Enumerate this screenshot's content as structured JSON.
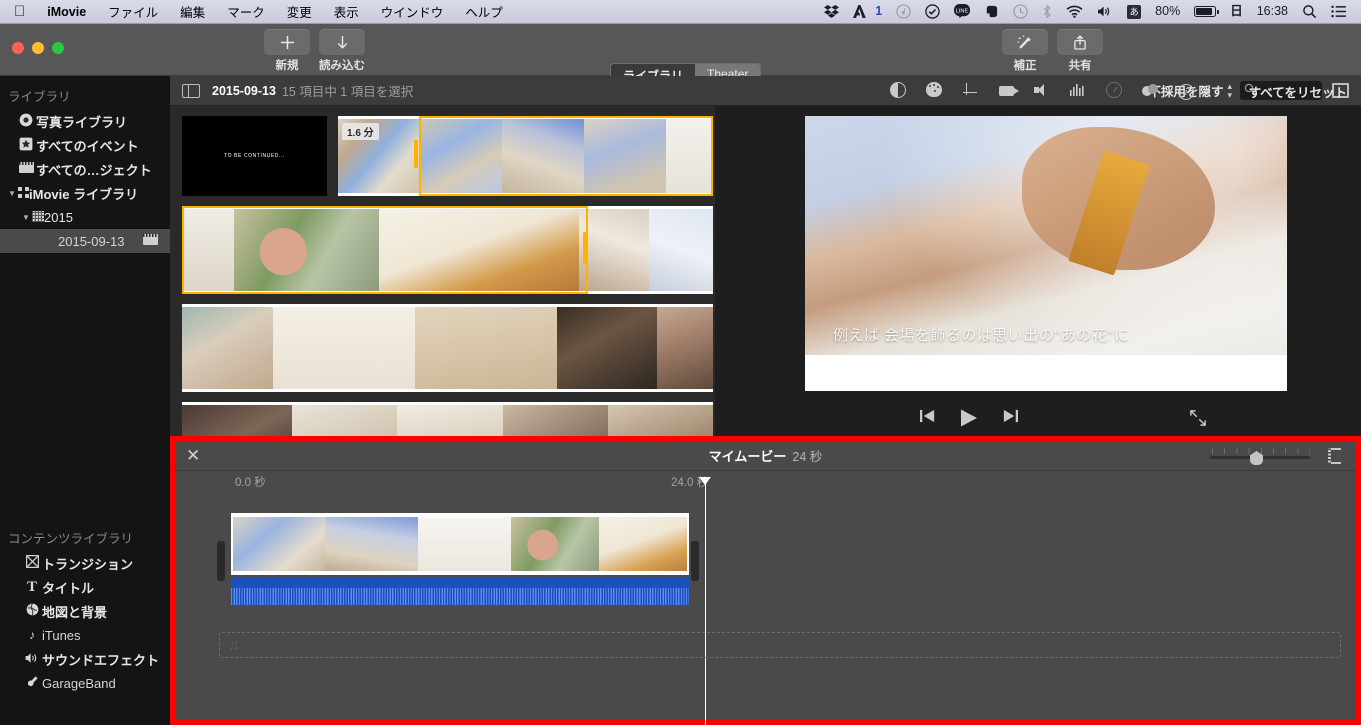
{
  "menubar": {
    "apple": "apple-logo",
    "items": [
      "iMovie",
      "ファイル",
      "編集",
      "マーク",
      "変更",
      "表示",
      "ウインドウ",
      "ヘルプ"
    ],
    "status": {
      "dropbox": "dropbox-icon",
      "adobe_badge": "1",
      "input_source": "あ",
      "battery_percent": "80%",
      "date_icon": "日",
      "time": "16:38"
    }
  },
  "titlebar": {
    "buttons": [
      {
        "name": "new",
        "glyph": "+",
        "label": "新規"
      },
      {
        "name": "import",
        "glyph": "↓",
        "label": "読み込む"
      },
      {
        "name": "enhance",
        "glyph": "✨",
        "label": "補正"
      },
      {
        "name": "share",
        "glyph": "⬆",
        "label": "共有"
      }
    ],
    "segments": [
      {
        "label": "ライブラリ",
        "selected": true
      },
      {
        "label": "Theater",
        "selected": false
      }
    ]
  },
  "sidebar": {
    "library_header": "ライブラリ",
    "library_items": [
      {
        "label": "写真ライブラリ",
        "icon": "photos-icon"
      },
      {
        "label": "すべてのイベント",
        "icon": "star-icon"
      },
      {
        "label": "すべての…ジェクト",
        "icon": "film-icon"
      }
    ],
    "imovie_library": "iMovie ライブラリ",
    "year": "2015",
    "event": "2015-09-13",
    "content_header": "コンテンツライブラリ",
    "content_items": [
      {
        "label": "トランジション",
        "icon": "transition-icon",
        "bold": true
      },
      {
        "label": "タイトル",
        "icon": "title-icon",
        "bold": true
      },
      {
        "label": "地図と背景",
        "icon": "globe-icon",
        "bold": true
      },
      {
        "label": "iTunes",
        "icon": "music-note-icon",
        "bold": false
      },
      {
        "label": "サウンドエフェクト",
        "icon": "speaker-icon",
        "bold": true
      },
      {
        "label": "GarageBand",
        "icon": "guitar-icon",
        "bold": false
      }
    ]
  },
  "browser_toolbar": {
    "sidebar_toggle": "sidebar-toggle-icon",
    "date": "2015-09-13",
    "count": "15 項目中 1 項目を選択",
    "hide_rejected": "不採用を隠す",
    "search_placeholder": "",
    "search_value": "",
    "filmstrip_view": "filmstrip-view-icon"
  },
  "adjust_bar": {
    "icons": [
      {
        "name": "color-balance-icon",
        "dim": false
      },
      {
        "name": "color-correction-icon",
        "dim": false
      },
      {
        "name": "crop-icon",
        "dim": false
      },
      {
        "name": "stabilization-icon",
        "dim": false
      },
      {
        "name": "volume-icon",
        "dim": false
      },
      {
        "name": "noise-reduction-icon",
        "dim": true
      },
      {
        "name": "speed-icon",
        "dim": true
      },
      {
        "name": "clip-filter-icon",
        "dim": false
      },
      {
        "name": "info-icon",
        "dim": false
      }
    ],
    "reset_all": "すべてをリセット"
  },
  "browser": {
    "clip1_label": "TO BE CONTINUED...",
    "clip2_duration": "1.6 分"
  },
  "viewer": {
    "caption": "例えば 会場を飾るのは思い出の\"あの花\"に",
    "controls": [
      {
        "name": "skip-to-start-button",
        "glyph": "|◀"
      },
      {
        "name": "play-button",
        "glyph": "▶"
      },
      {
        "name": "skip-to-end-button",
        "glyph": "▶|"
      },
      {
        "name": "fullscreen-button",
        "glyph": "⤢"
      }
    ]
  },
  "timeline": {
    "close": "✕",
    "project_title": "マイムービー",
    "duration": "24 秒",
    "ruler_start": "0.0 秒",
    "ruler_end": "24.0 秒",
    "zoom_value": 40,
    "music_dropzone_icon": "music-note-icon",
    "video_clip_name": "video-clip",
    "audio_clip_name": "audio-clip"
  }
}
